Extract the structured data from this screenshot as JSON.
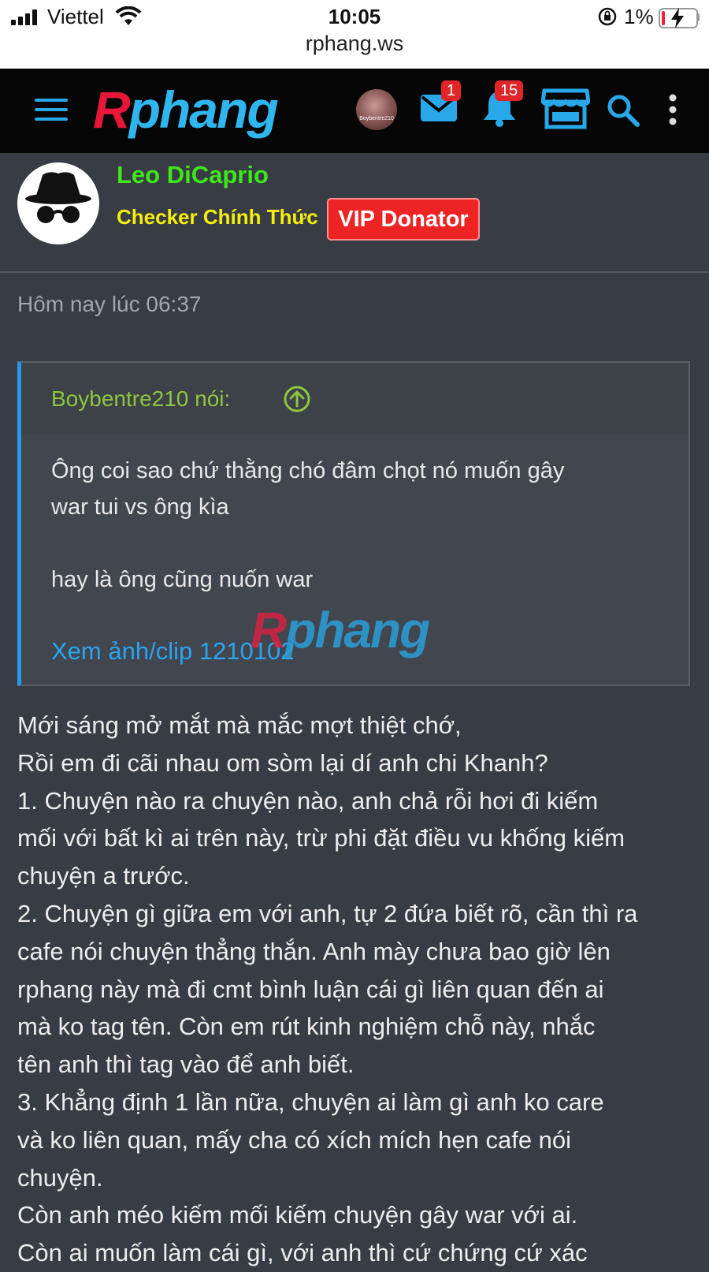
{
  "status_bar": {
    "carrier": "Viettel",
    "time": "10:05",
    "url": "rphang.ws",
    "battery_pct": "1%",
    "battery_level": 0.01
  },
  "nav": {
    "logo_r": "R",
    "logo_rest": "phang",
    "avatar_text": "Boybentre210",
    "messages_badge": "1",
    "alerts_badge": "15"
  },
  "post": {
    "author": "Leo DiCaprio",
    "user_title": "Checker Chính Thức",
    "banner": "VIP Donator",
    "date": "Hôm nay lúc 06:37",
    "quote": {
      "author": "Boybentre210 nói:",
      "body": "Ông coi sao chứ thằng chó đâm chọt nó muốn gây\nwar tui vs ông kìa\n\nhay là ông cũng nuốn war",
      "link": "Xem ảnh/clip 1210102"
    },
    "watermark_r": "R",
    "watermark_rest": "phang",
    "lines": [
      "Mới sáng mở mắt mà mắc mợt thiệt chớ,",
      "Rồi em đi cãi nhau om sòm lại dí anh chi Khanh?",
      "1. Chuyện nào ra chuyện nào, anh chả rỗi hơi đi kiếm",
      "mối với bất kì ai trên này, trừ phi đặt điều vu khống kiếm",
      "chuyện a trước.",
      "2. Chuyện gì giữa em với anh, tự 2 đứa biết rõ, cần thì ra",
      "cafe nói chuyện thẳng thắn. Anh mày chưa bao giờ lên",
      "rphang này mà đi cmt bình luận cái gì liên quan đến ai",
      "mà ko tag tên. Còn em rút kinh nghiệm chỗ này, nhắc",
      "tên anh thì tag vào để anh biết.",
      "3. Khẳng định 1 lần nữa, chuyện ai làm gì anh ko care",
      "và ko liên quan, mấy cha có xích mích hẹn cafe nói",
      "chuyện.",
      "Còn anh méo kiếm mối kiếm chuyện gây war với ai.",
      "Còn ai muốn làm cái gì, với anh thì cứ chứng cứ xác"
    ]
  }
}
